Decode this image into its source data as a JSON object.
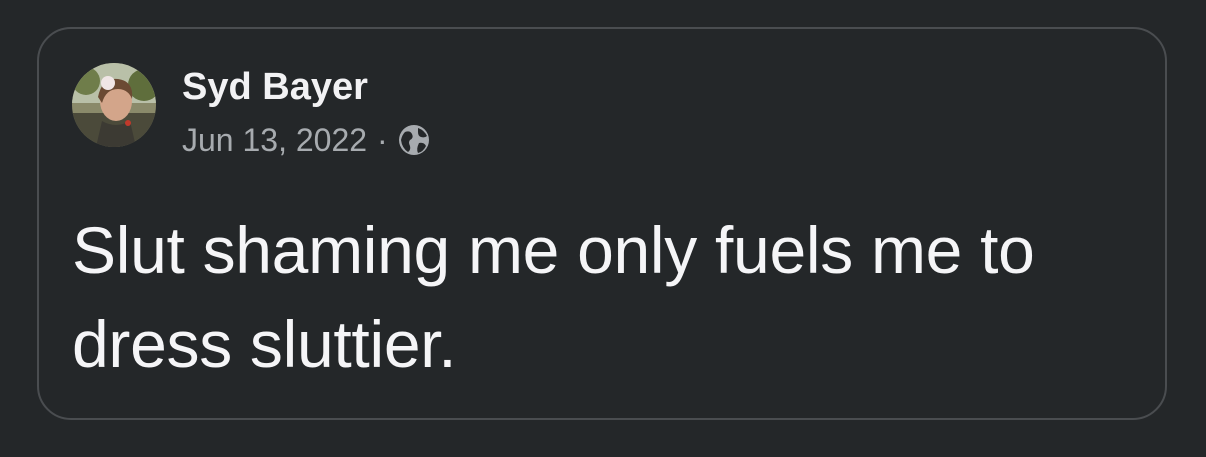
{
  "post": {
    "author_name": "Syd Bayer",
    "date": "Jun 13, 2022",
    "separator": "·",
    "visibility_icon": "globe-icon",
    "text": "Slut shaming me only fuels me to dress sluttier."
  },
  "colors": {
    "background": "#242729",
    "card_border": "#4a4d50",
    "primary_text": "#f5f5f7",
    "secondary_text": "#a7abaf"
  }
}
